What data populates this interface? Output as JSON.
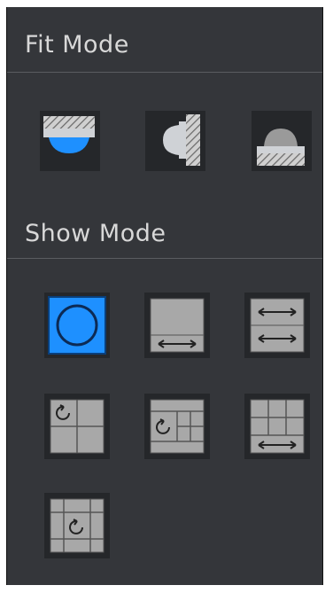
{
  "fit_mode": {
    "title": "Fit Mode",
    "options": [
      {
        "icon": "ceiling-mount-icon"
      },
      {
        "icon": "wall-mount-icon"
      },
      {
        "icon": "ground-mount-icon"
      }
    ]
  },
  "show_mode": {
    "title": "Show Mode",
    "options": [
      {
        "icon": "fisheye-original-icon",
        "selected": true
      },
      {
        "icon": "panorama-180-icon",
        "selected": false
      },
      {
        "icon": "dual-panorama-icon",
        "selected": false
      },
      {
        "icon": "fisheye-plus-3-icon",
        "selected": false
      },
      {
        "icon": "fisheye-plus-4-icon",
        "selected": false
      },
      {
        "icon": "panorama-plus-6-icon",
        "selected": false
      },
      {
        "icon": "fisheye-plus-8-icon",
        "selected": false
      }
    ]
  },
  "colors": {
    "panel_bg": "#34363a",
    "accent": "#1e90ff",
    "icon_gray": "#a8a8a8"
  }
}
